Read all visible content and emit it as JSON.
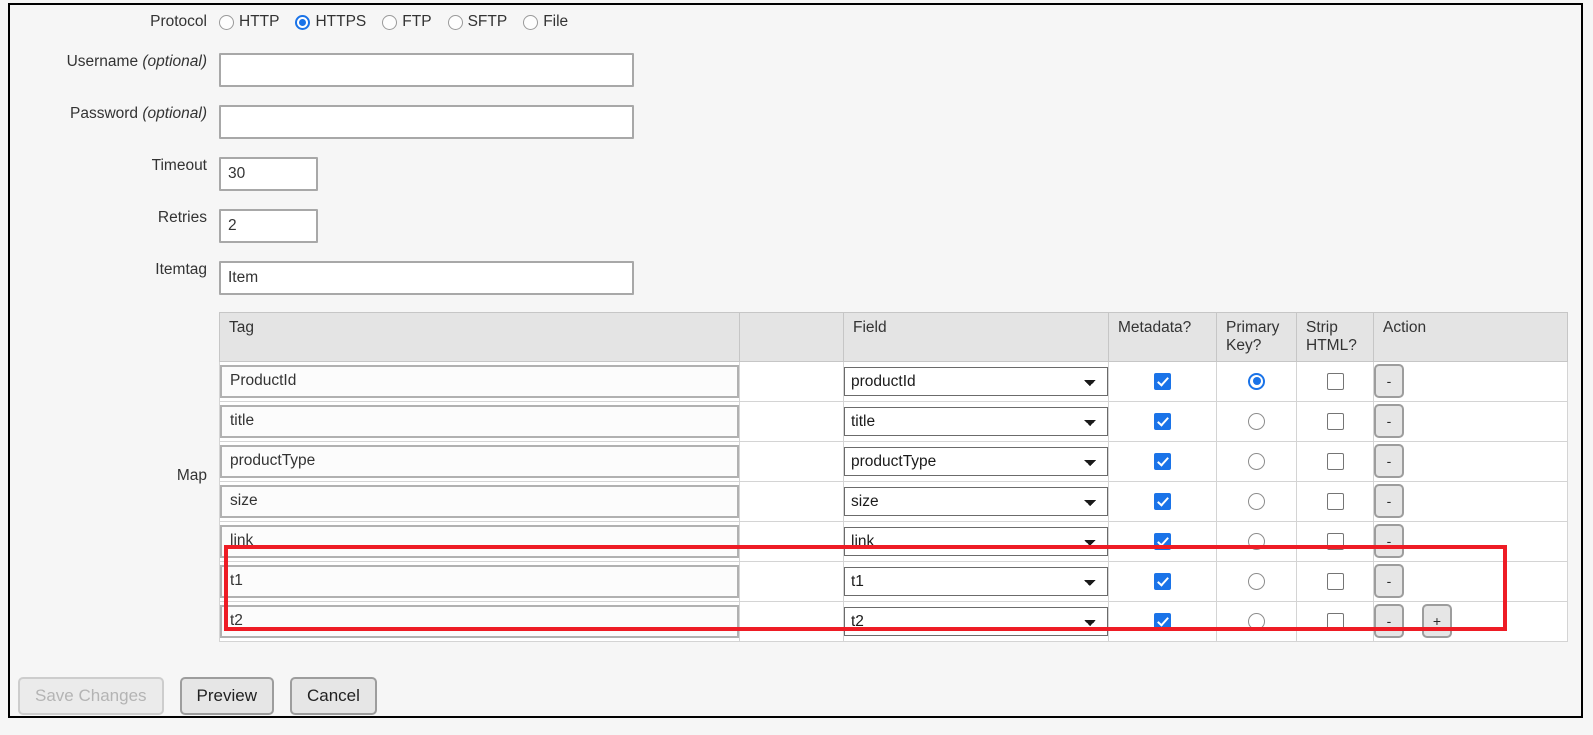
{
  "protocol": {
    "label": "Protocol",
    "options": [
      {
        "label": "HTTP",
        "selected": false
      },
      {
        "label": "HTTPS",
        "selected": true
      },
      {
        "label": "FTP",
        "selected": false
      },
      {
        "label": "SFTP",
        "selected": false
      },
      {
        "label": "File",
        "selected": false
      }
    ]
  },
  "fields": {
    "username": {
      "label": "Username",
      "hint": "(optional)",
      "value": ""
    },
    "password": {
      "label": "Password",
      "hint": "(optional)",
      "value": ""
    },
    "timeout": {
      "label": "Timeout",
      "value": "30"
    },
    "retries": {
      "label": "Retries",
      "value": "2"
    },
    "itemtag": {
      "label": "Itemtag",
      "value": "Item"
    }
  },
  "map": {
    "label": "Map",
    "columns": [
      "Tag",
      "",
      "Field",
      "Metadata?",
      "Primary Key?",
      "Strip HTML?",
      "Action"
    ],
    "column_headers": {
      "tag": "Tag",
      "spacer": "",
      "field": "Field",
      "metadata": "Metadata?",
      "primary_key": "Primary Key?",
      "strip_html": "Strip HTML?",
      "action": "Action"
    },
    "rows": [
      {
        "tag": "ProductId",
        "field": "productId",
        "metadata": true,
        "primary_key": true,
        "strip_html": false,
        "remove_label": "-",
        "add_label": null,
        "highlighted": false
      },
      {
        "tag": "title",
        "field": "title",
        "metadata": true,
        "primary_key": false,
        "strip_html": false,
        "remove_label": "-",
        "add_label": null,
        "highlighted": false
      },
      {
        "tag": "productType",
        "field": "productType",
        "metadata": true,
        "primary_key": false,
        "strip_html": false,
        "remove_label": "-",
        "add_label": null,
        "highlighted": false
      },
      {
        "tag": "size",
        "field": "size",
        "metadata": true,
        "primary_key": false,
        "strip_html": false,
        "remove_label": "-",
        "add_label": null,
        "highlighted": false
      },
      {
        "tag": "link",
        "field": "link",
        "metadata": true,
        "primary_key": false,
        "strip_html": false,
        "remove_label": "-",
        "add_label": null,
        "highlighted": false
      },
      {
        "tag": "t1",
        "field": "t1",
        "metadata": true,
        "primary_key": false,
        "strip_html": false,
        "remove_label": "-",
        "add_label": null,
        "highlighted": true
      },
      {
        "tag": "t2",
        "field": "t2",
        "metadata": true,
        "primary_key": false,
        "strip_html": false,
        "remove_label": "-",
        "add_label": "+",
        "highlighted": true
      }
    ]
  },
  "buttons": {
    "save": {
      "label": "Save Changes",
      "disabled": true
    },
    "preview": {
      "label": "Preview",
      "disabled": false
    },
    "cancel": {
      "label": "Cancel",
      "disabled": false
    }
  },
  "colors": {
    "accent": "#1a73e8",
    "highlight": "#ee1c25",
    "header_bg": "#e4e4e4",
    "page_bg": "#f6f6f6"
  }
}
